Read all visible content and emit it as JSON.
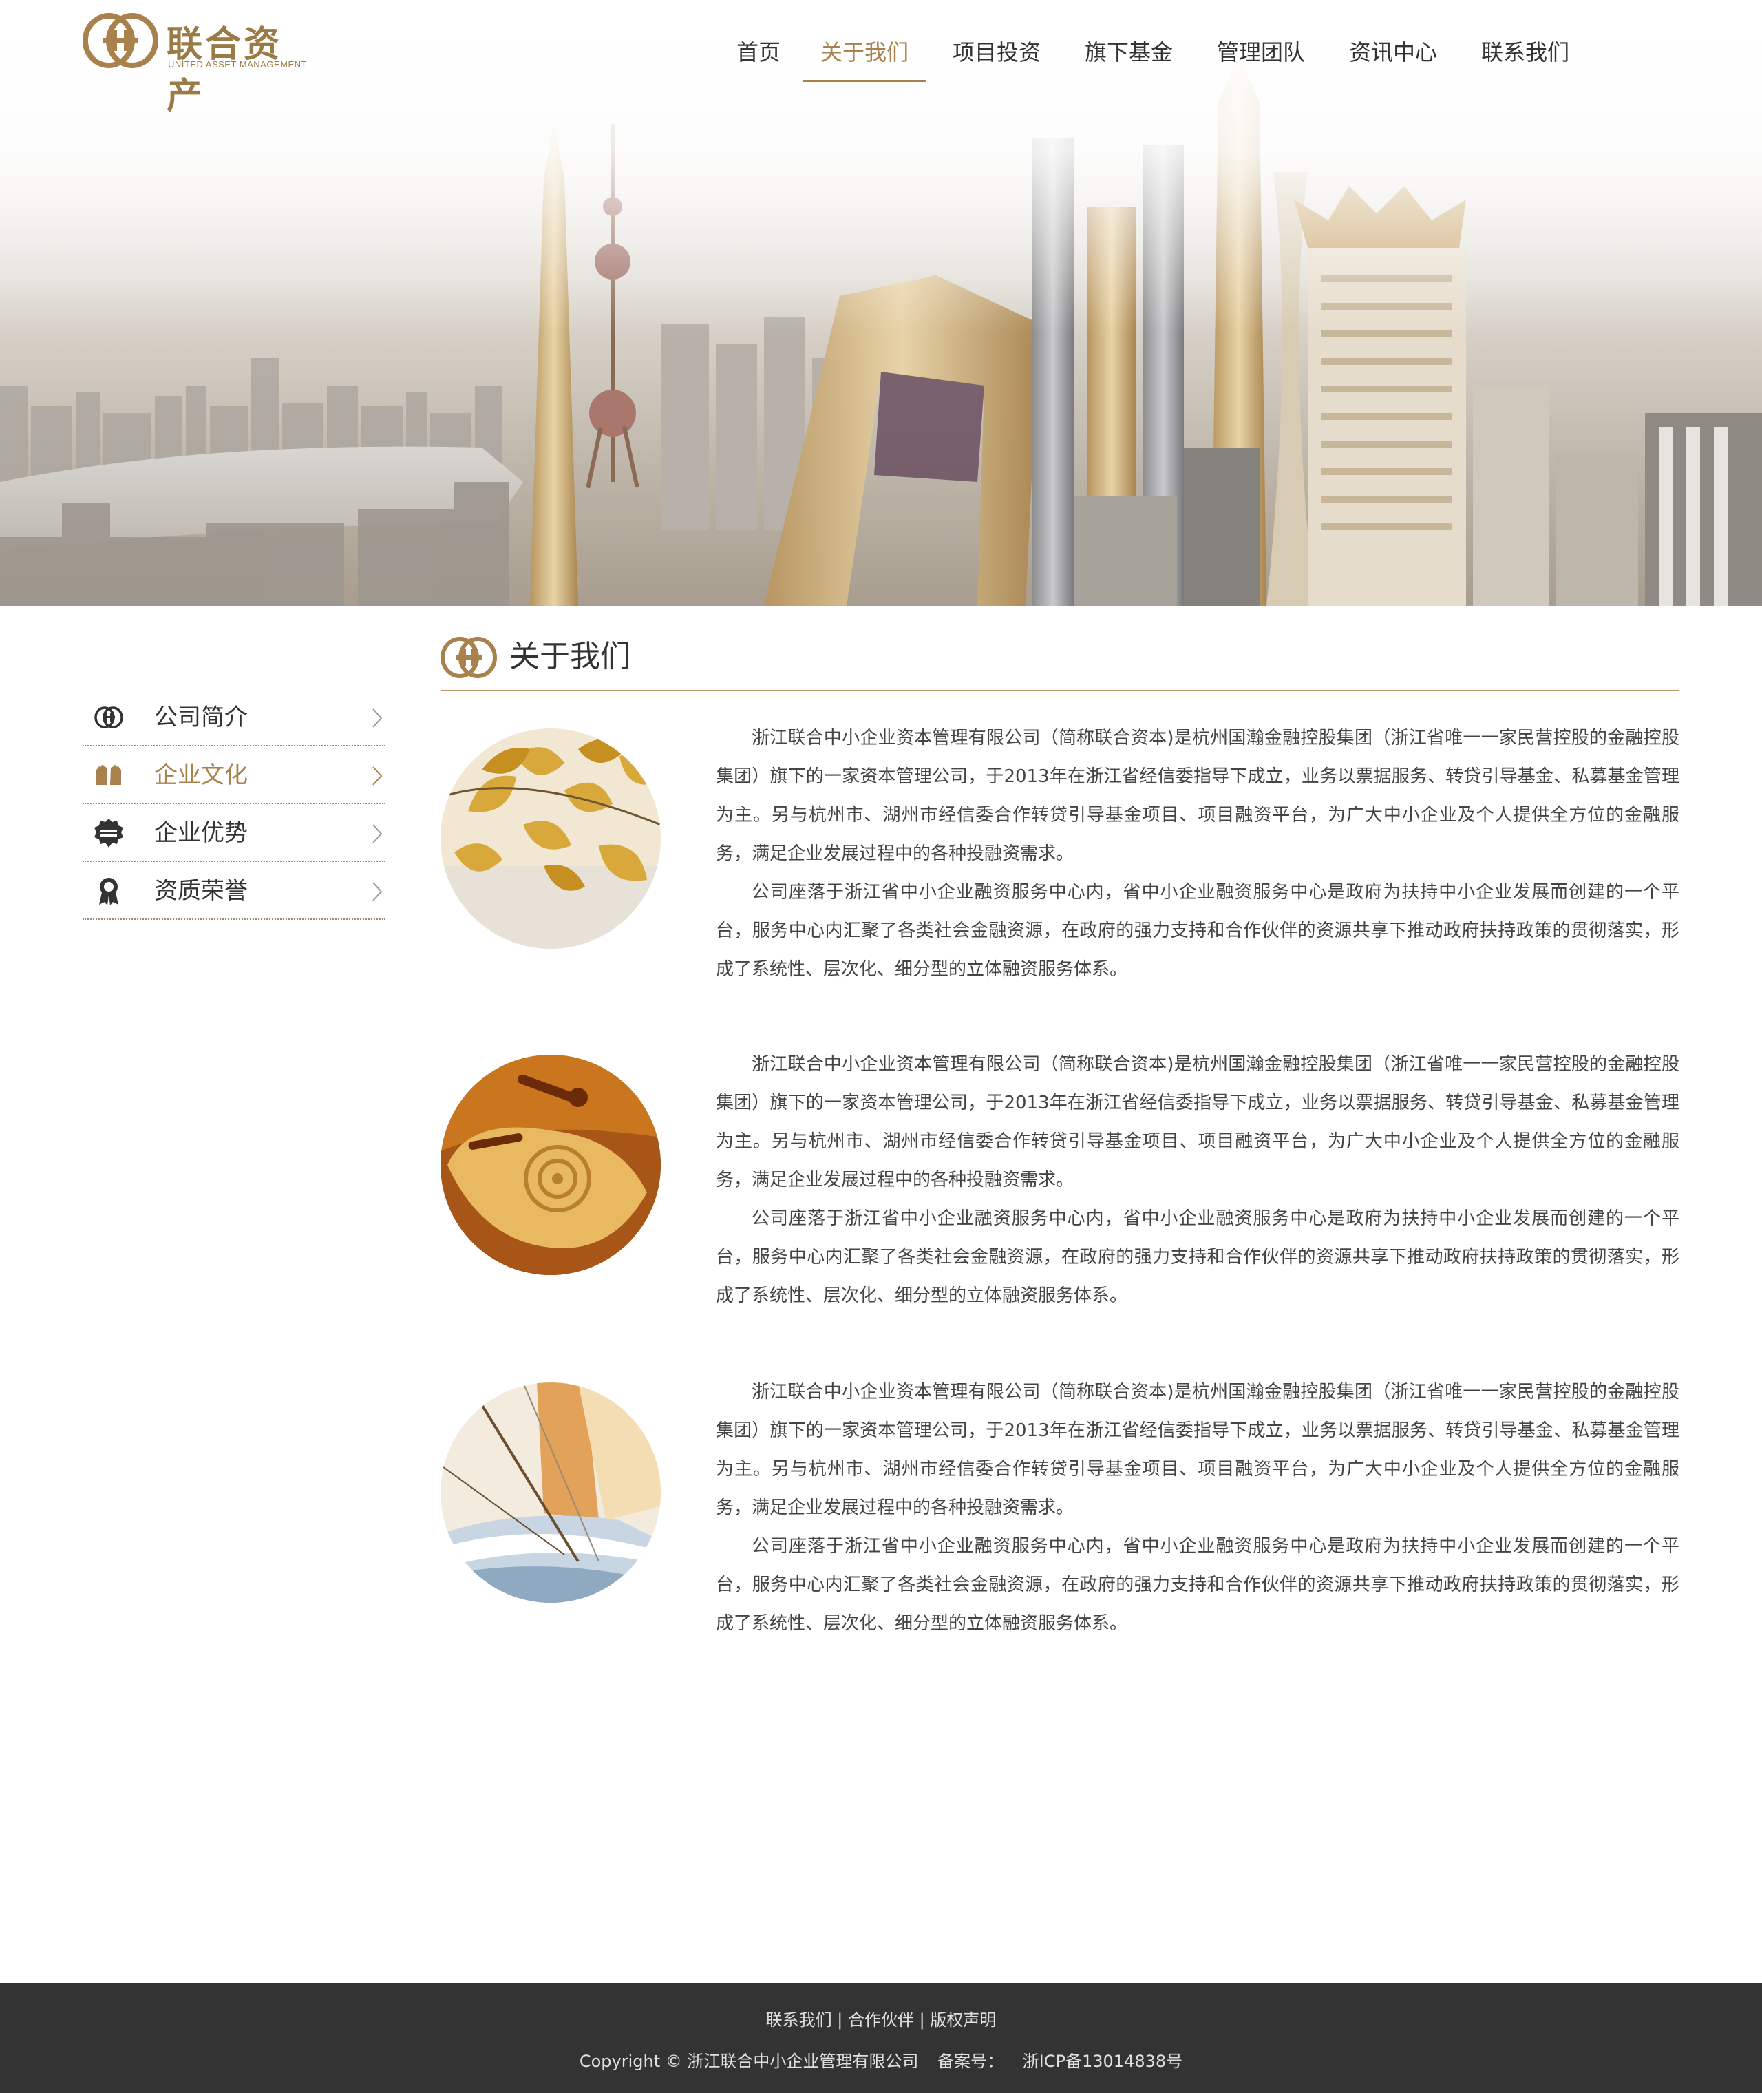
{
  "brand": {
    "name_cn": "联合资产",
    "name_en": "UNITED ASSET MANAGEMENT"
  },
  "nav": {
    "items": [
      "首页",
      "关于我们",
      "项目投资",
      "旗下基金",
      "管理团队",
      "资讯中心",
      "联系我们"
    ],
    "active": "关于我们"
  },
  "sidebar": {
    "items": [
      {
        "label": "公司简介",
        "icon": "coin-logo-icon"
      },
      {
        "label": "企业文化",
        "icon": "hands-icon"
      },
      {
        "label": "企业优势",
        "icon": "best-choice-badge-icon"
      },
      {
        "label": "资质荣誉",
        "icon": "award-ribbon-icon"
      }
    ],
    "active": "企业文化"
  },
  "section": {
    "title": "关于我们"
  },
  "articles": [
    {
      "image": "ginkgo-leaves-photo",
      "p1": "浙江联合中小企业资本管理有限公司（简称联合资本)是杭州国瀚金融控股集团（浙江省唯一一家民营控股的金融控股集团）旗下的一家资本管理公司，于2013年在浙江省经信委指导下成立，业务以票据服务、转贷引导基金、私募基金管理为主。另与杭州市、湖州市经信委合作转贷引导基金项目、项目融资平台，为广大中小企业及个人提供全方位的金融服务，满足企业发展过程中的各种投融资需求。",
      "p2": "公司座落于浙江省中小企业融资服务中心内，省中小企业融资服务中心是政府为扶持中小企业发展而创建的一个平台，服务中心内汇聚了各类社会金融资源，在政府的强力支持和合作伙伴的资源共享下推动政府扶持政策的贯彻落实，形成了系统性、层次化、细分型的立体融资服务体系。"
    },
    {
      "image": "violin-scroll-photo",
      "p1": "浙江联合中小企业资本管理有限公司（简称联合资本)是杭州国瀚金融控股集团（浙江省唯一一家民营控股的金融控股集团）旗下的一家资本管理公司，于2013年在浙江省经信委指导下成立，业务以票据服务、转贷引导基金、私募基金管理为主。另与杭州市、湖州市经信委合作转贷引导基金项目、项目融资平台，为广大中小企业及个人提供全方位的金融服务，满足企业发展过程中的各种投融资需求。",
      "p2": "公司座落于浙江省中小企业融资服务中心内，省中小企业融资服务中心是政府为扶持中小企业发展而创建的一个平台，服务中心内汇聚了各类社会金融资源，在政府的强力支持和合作伙伴的资源共享下推动政府扶持政策的贯彻落实，形成了系统性、层次化、细分型的立体融资服务体系。"
    },
    {
      "image": "sailboat-photo",
      "p1": "浙江联合中小企业资本管理有限公司（简称联合资本)是杭州国瀚金融控股集团（浙江省唯一一家民营控股的金融控股集团）旗下的一家资本管理公司，于2013年在浙江省经信委指导下成立，业务以票据服务、转贷引导基金、私募基金管理为主。另与杭州市、湖州市经信委合作转贷引导基金项目、项目融资平台，为广大中小企业及个人提供全方位的金融服务，满足企业发展过程中的各种投融资需求。",
      "p2": "公司座落于浙江省中小企业融资服务中心内，省中小企业融资服务中心是政府为扶持中小企业发展而创建的一个平台，服务中心内汇聚了各类社会金融资源，在政府的强力支持和合作伙伴的资源共享下推动政府扶持政策的贯彻落实，形成了系统性、层次化、细分型的立体融资服务体系。"
    }
  ],
  "footer": {
    "links": [
      "联系我们",
      "合作伙伴",
      "版权声明"
    ],
    "copyright": "Copyright © 浙江联合中小企业管理有限公司",
    "icp_label": "备案号：",
    "icp_number": "浙ICP备13014838号"
  },
  "colors": {
    "accent": "#a8814c",
    "footer_bg": "#333333",
    "text": "#444444"
  }
}
